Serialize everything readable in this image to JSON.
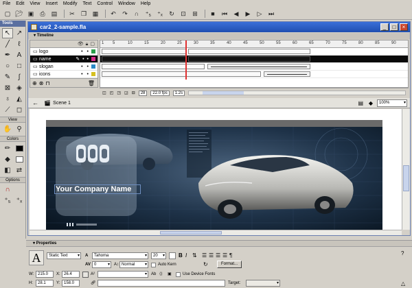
{
  "menu": [
    "File",
    "Edit",
    "View",
    "Insert",
    "Modify",
    "Text",
    "Control",
    "Window",
    "Help"
  ],
  "tools_panel": {
    "title": "Tools",
    "sections": {
      "view": "View",
      "colors": "Colors",
      "options": "Options"
    }
  },
  "document": {
    "title": "car2_2-sample.fla",
    "timeline_label": "Timeline",
    "layers": [
      {
        "name": "logo",
        "flag_color": "#2aa04a"
      },
      {
        "name": "name",
        "flag_color": "#d62a8a",
        "selected": true
      },
      {
        "name": "slogan",
        "flag_color": "#2a8ac6"
      },
      {
        "name": "icons",
        "flag_color": "#d6c020"
      }
    ],
    "ruler_ticks": [
      "1",
      "5",
      "10",
      "15",
      "20",
      "25",
      "30",
      "35",
      "40",
      "45",
      "50",
      "55",
      "60",
      "65",
      "70",
      "75",
      "80",
      "85",
      "90"
    ],
    "status": {
      "frame": "28",
      "fps": "22.0 fps",
      "time": "1.2s"
    },
    "scene": "Scene 1",
    "zoom": "100%"
  },
  "stage": {
    "company_name": "Your Company Name"
  },
  "properties": {
    "title": "Properties",
    "text_type": "Static Text",
    "font": "Tahoma",
    "size": "20",
    "tracking": "0",
    "baseline": "Normal",
    "auto_kern": "Auto Kern",
    "format_button": "Format...",
    "w": "215.0",
    "x": "26.4",
    "h": "28.1",
    "y": "158.0",
    "device_fonts": "Use Device Fonts",
    "target_label": "Target:",
    "labels": {
      "w": "W:",
      "x": "X:",
      "h": "H:",
      "y": "Y:"
    }
  },
  "colors": {
    "title_bar": "#1f4fb0",
    "panel_header": "#5a6fa0",
    "playhead": "#e03030",
    "stage_bg": "#14263a"
  }
}
